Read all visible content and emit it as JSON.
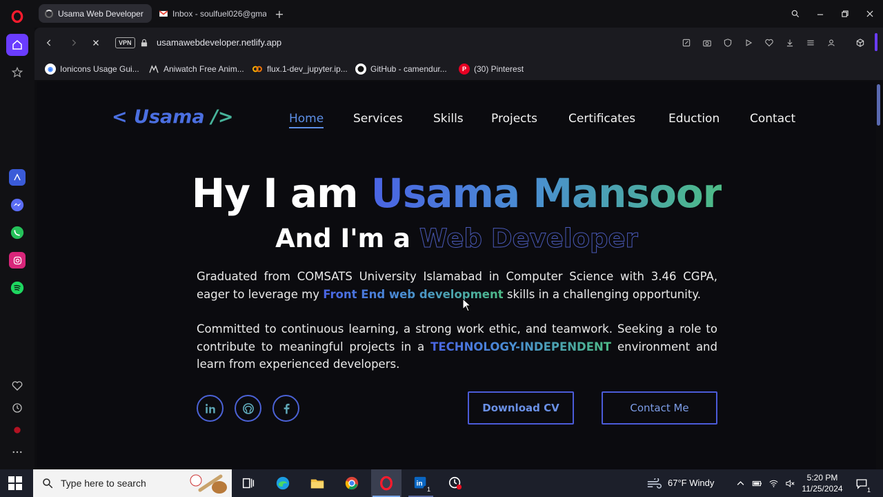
{
  "tabs": [
    {
      "label": "Usama Web Developer",
      "active": true
    },
    {
      "label": "Inbox - soulfuel026@gma",
      "active": false
    }
  ],
  "address": {
    "vpn": "VPN",
    "url": "usamawebdeveloper.netlify.app"
  },
  "bookmarks": [
    {
      "label": "Ionicons Usage Gui..."
    },
    {
      "label": "Aniwatch Free Anim..."
    },
    {
      "label": "flux.1-dev_jupyter.ip..."
    },
    {
      "label": "GitHub - camendur..."
    },
    {
      "label": "(30) Pinterest"
    }
  ],
  "site": {
    "logo_left": "< Usama ",
    "logo_right": "/>",
    "nav": [
      {
        "label": "Home",
        "active": true
      },
      {
        "label": "Services"
      },
      {
        "label": "Skills"
      },
      {
        "label": "Projects"
      },
      {
        "label": "Certificates"
      },
      {
        "label": "Eduction"
      },
      {
        "label": "Contact"
      }
    ],
    "hero_prefix": "Hy I am ",
    "hero_name": "Usama Mansoor",
    "role_prefix": "And I'm a ",
    "role": "Web Developer",
    "para1_a": "Graduated from COMSATS University Islamabad in Computer Science with 3.46 CGPA, eager to leverage my ",
    "para1_hl": "Front End web development",
    "para1_b": " skills in a challenging opportunity.",
    "para2_a": "Committed to continuous learning, a strong work ethic, and teamwork. Seeking a role to contribute to meaningful projects in a ",
    "para2_hl": "TECHNOLOGY-INDEPENDENT",
    "para2_b": " environment and learn from experienced developers.",
    "download_cv": "Download CV",
    "contact_me": "Contact Me"
  },
  "taskbar": {
    "search_placeholder": "Type here to search",
    "weather": "67°F  Windy",
    "time": "5:20 PM",
    "date": "11/25/2024",
    "linkedin_badge": "1",
    "notif_badge": "1"
  },
  "colors": {
    "accent": "#6a3cff",
    "brand_blue": "#4b62d6",
    "brand_green": "#4dbb86"
  }
}
